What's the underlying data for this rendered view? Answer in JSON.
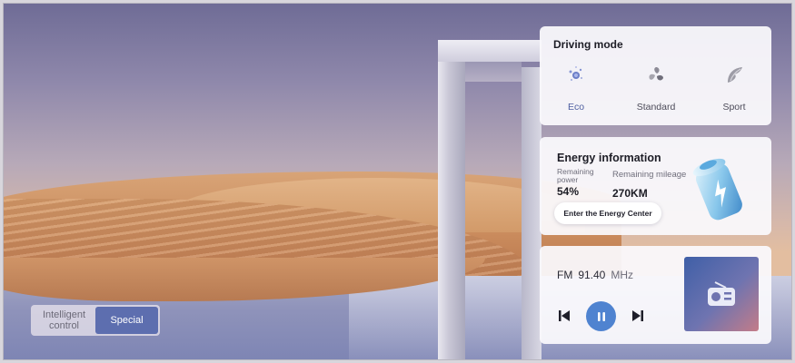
{
  "background": {
    "scene": "desert-dunes-with-mirror-arch"
  },
  "segment_control": {
    "options": [
      {
        "label": "Intelligent\ncontrol",
        "active": false
      },
      {
        "label": "Special",
        "active": true
      }
    ],
    "accent": "#5d6eaf"
  },
  "driving_mode": {
    "title": "Driving mode",
    "modes": [
      {
        "label": "Eco",
        "icon": "eco-sparkle-icon",
        "selected": true
      },
      {
        "label": "Standard",
        "icon": "standard-swirl-icon",
        "selected": false
      },
      {
        "label": "Sport",
        "icon": "sport-leaf-icon",
        "selected": false
      }
    ],
    "selected_color": "#4e5fa1"
  },
  "energy": {
    "title": "Energy information",
    "remaining_power_label": "Remaining\npower",
    "remaining_power_value": "54%",
    "remaining_mileage_label": "Remaining mileage",
    "remaining_mileage_value": "270KM",
    "button_label": "Enter the Energy Center",
    "icon": "battery-bolt-icon"
  },
  "radio": {
    "band": "FM",
    "frequency": "91.40",
    "unit": "MHz",
    "controls": [
      "previous-icon",
      "pause-icon",
      "next-icon"
    ],
    "art_icon": "radio-icon",
    "play_color": "#4f83d0"
  }
}
